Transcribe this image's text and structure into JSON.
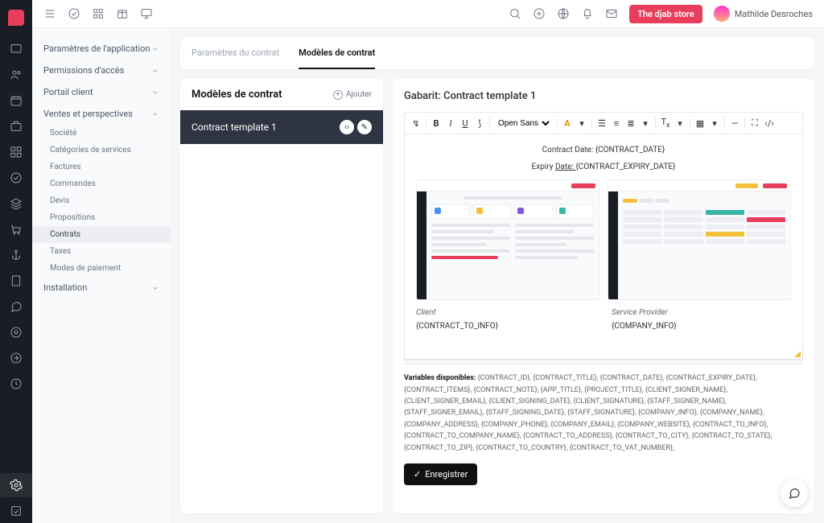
{
  "topbar": {
    "store_btn": "The djab store",
    "user_name": "Mathilde Desroches"
  },
  "sidebar": {
    "sections": [
      {
        "label": "Paramètres de l'application",
        "open": false
      },
      {
        "label": "Permissions d'accès",
        "open": false
      },
      {
        "label": "Portail client",
        "open": false
      },
      {
        "label": "Ventes et perspectives",
        "open": true,
        "subs": [
          {
            "label": "Société"
          },
          {
            "label": "Catégories de services"
          },
          {
            "label": "Factures"
          },
          {
            "label": "Commandes"
          },
          {
            "label": "Devis"
          },
          {
            "label": "Propositions"
          },
          {
            "label": "Contrats",
            "active": true
          },
          {
            "label": "Taxes"
          },
          {
            "label": "Modes de paiement"
          }
        ]
      },
      {
        "label": "Installation",
        "open": false
      }
    ]
  },
  "tabs": [
    {
      "label": "Paramètres du contrat",
      "active": false
    },
    {
      "label": "Modèles de contrat",
      "active": true
    }
  ],
  "list": {
    "title": "Modèles de contrat",
    "add_label": "Ajouter",
    "items": [
      {
        "label": "Contract template 1",
        "active": true
      }
    ]
  },
  "editor": {
    "title_prefix": "Gabarit: ",
    "title_name": "Contract template 1",
    "font_family": "Open Sans",
    "body": {
      "line1": "Contract Date: {CONTRACT_DATE}",
      "line2_a": "Expiry ",
      "line2_b": "Date: ",
      "line2_c": " {CONTRACT_EXPIRY_DATE}",
      "client_label": "Client",
      "sp_label": "Service Provider",
      "client_val": "{CONTRACT_TO_INFO}",
      "sp_val": "{COMPANY_INFO}"
    },
    "vars_label": "Variables disponibles:",
    "vars_list": "{CONTRACT_ID}, {CONTRACT_TITLE}, {CONTRACT_DATE}, {CONTRACT_EXPIRY_DATE}, {CONTRACT_ITEMS}, {CONTRACT_NOTE}, {APP_TITLE}, {PROJECT_TITLE}, {CLIENT_SIGNER_NAME}, {CLIENT_SIGNER_EMAIL}, {CLIENT_SIGNING_DATE}, {CLIENT_SIGNATURE}, {STAFF_SIGNER_NAME}, {STAFF_SIGNER_EMAIL}, {STAFF_SIGNING_DATE}, {STAFF_SIGNATURE}, {COMPANY_INFO}, {COMPANY_NAME}, {COMPANY_ADDRESS}, {COMPANY_PHONE}, {COMPANY_EMAIL}, {COMPANY_WEBSITE}, {CONTRACT_TO_INFO}, {CONTRACT_TO_COMPANY_NAME}, {CONTRACT_TO_ADDRESS}, {CONTRACT_TO_CITY}, {CONTRACT_TO_STATE}, {CONTRACT_TO_ZIP}, {CONTRACT_TO_COUNTRY}, {CONTRACT_TO_VAT_NUMBER},",
    "save_label": "Enregistrer"
  }
}
